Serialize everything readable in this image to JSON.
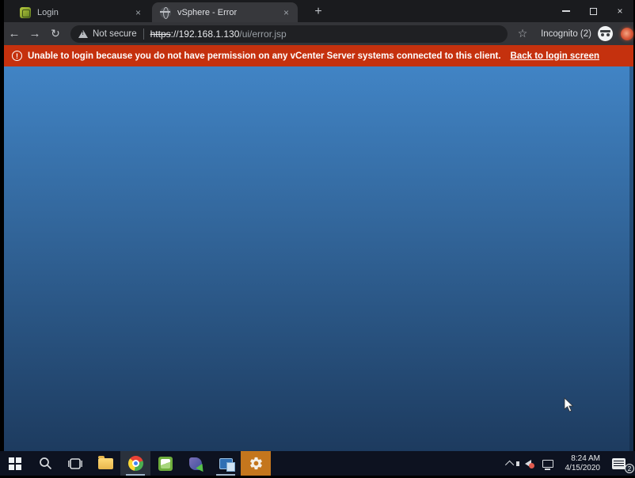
{
  "window_controls": {
    "minimize": "minimize",
    "restore": "restore",
    "close": "×"
  },
  "tabs": {
    "login": {
      "title": "Login",
      "close_glyph": "×"
    },
    "error": {
      "title": "vSphere - Error",
      "close_glyph": "×"
    },
    "new_tab_glyph": "+"
  },
  "toolbar": {
    "back_glyph": "←",
    "forward_glyph": "→",
    "reload_glyph": "↻",
    "not_secure_label": "Not secure",
    "url": {
      "scheme": "https",
      "host": "://192.168.1.130",
      "path": "/ui/error.jsp"
    },
    "star_glyph": "☆",
    "incognito_label": "Incognito (2)"
  },
  "banner": {
    "icon_glyph": "!",
    "message": "Unable to login because you do not have permission on any vCenter Server systems connected to this client.",
    "link_label": "Back to login screen"
  },
  "taskbar": {
    "clock_time": "8:24 AM",
    "clock_date": "4/15/2020",
    "notification_count": "2"
  },
  "colors": {
    "banner_bg": "#c5310e",
    "page_gradient_top": "#4184c5",
    "page_gradient_bottom": "#1d3b5f",
    "attention_orange": "#c4761d"
  }
}
